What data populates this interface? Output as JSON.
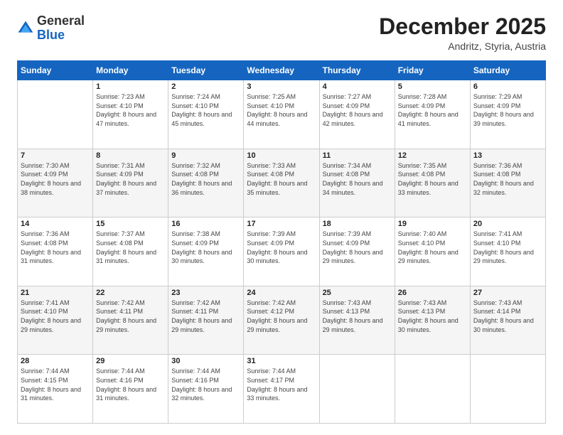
{
  "header": {
    "logo_general": "General",
    "logo_blue": "Blue",
    "month_title": "December 2025",
    "location": "Andritz, Styria, Austria"
  },
  "weekdays": [
    "Sunday",
    "Monday",
    "Tuesday",
    "Wednesday",
    "Thursday",
    "Friday",
    "Saturday"
  ],
  "weeks": [
    [
      {
        "day": "",
        "sunrise": "",
        "sunset": "",
        "daylight": ""
      },
      {
        "day": "1",
        "sunrise": "Sunrise: 7:23 AM",
        "sunset": "Sunset: 4:10 PM",
        "daylight": "Daylight: 8 hours and 47 minutes."
      },
      {
        "day": "2",
        "sunrise": "Sunrise: 7:24 AM",
        "sunset": "Sunset: 4:10 PM",
        "daylight": "Daylight: 8 hours and 45 minutes."
      },
      {
        "day": "3",
        "sunrise": "Sunrise: 7:25 AM",
        "sunset": "Sunset: 4:10 PM",
        "daylight": "Daylight: 8 hours and 44 minutes."
      },
      {
        "day": "4",
        "sunrise": "Sunrise: 7:27 AM",
        "sunset": "Sunset: 4:09 PM",
        "daylight": "Daylight: 8 hours and 42 minutes."
      },
      {
        "day": "5",
        "sunrise": "Sunrise: 7:28 AM",
        "sunset": "Sunset: 4:09 PM",
        "daylight": "Daylight: 8 hours and 41 minutes."
      },
      {
        "day": "6",
        "sunrise": "Sunrise: 7:29 AM",
        "sunset": "Sunset: 4:09 PM",
        "daylight": "Daylight: 8 hours and 39 minutes."
      }
    ],
    [
      {
        "day": "7",
        "sunrise": "Sunrise: 7:30 AM",
        "sunset": "Sunset: 4:09 PM",
        "daylight": "Daylight: 8 hours and 38 minutes."
      },
      {
        "day": "8",
        "sunrise": "Sunrise: 7:31 AM",
        "sunset": "Sunset: 4:09 PM",
        "daylight": "Daylight: 8 hours and 37 minutes."
      },
      {
        "day": "9",
        "sunrise": "Sunrise: 7:32 AM",
        "sunset": "Sunset: 4:08 PM",
        "daylight": "Daylight: 8 hours and 36 minutes."
      },
      {
        "day": "10",
        "sunrise": "Sunrise: 7:33 AM",
        "sunset": "Sunset: 4:08 PM",
        "daylight": "Daylight: 8 hours and 35 minutes."
      },
      {
        "day": "11",
        "sunrise": "Sunrise: 7:34 AM",
        "sunset": "Sunset: 4:08 PM",
        "daylight": "Daylight: 8 hours and 34 minutes."
      },
      {
        "day": "12",
        "sunrise": "Sunrise: 7:35 AM",
        "sunset": "Sunset: 4:08 PM",
        "daylight": "Daylight: 8 hours and 33 minutes."
      },
      {
        "day": "13",
        "sunrise": "Sunrise: 7:36 AM",
        "sunset": "Sunset: 4:08 PM",
        "daylight": "Daylight: 8 hours and 32 minutes."
      }
    ],
    [
      {
        "day": "14",
        "sunrise": "Sunrise: 7:36 AM",
        "sunset": "Sunset: 4:08 PM",
        "daylight": "Daylight: 8 hours and 31 minutes."
      },
      {
        "day": "15",
        "sunrise": "Sunrise: 7:37 AM",
        "sunset": "Sunset: 4:08 PM",
        "daylight": "Daylight: 8 hours and 31 minutes."
      },
      {
        "day": "16",
        "sunrise": "Sunrise: 7:38 AM",
        "sunset": "Sunset: 4:09 PM",
        "daylight": "Daylight: 8 hours and 30 minutes."
      },
      {
        "day": "17",
        "sunrise": "Sunrise: 7:39 AM",
        "sunset": "Sunset: 4:09 PM",
        "daylight": "Daylight: 8 hours and 30 minutes."
      },
      {
        "day": "18",
        "sunrise": "Sunrise: 7:39 AM",
        "sunset": "Sunset: 4:09 PM",
        "daylight": "Daylight: 8 hours and 29 minutes."
      },
      {
        "day": "19",
        "sunrise": "Sunrise: 7:40 AM",
        "sunset": "Sunset: 4:10 PM",
        "daylight": "Daylight: 8 hours and 29 minutes."
      },
      {
        "day": "20",
        "sunrise": "Sunrise: 7:41 AM",
        "sunset": "Sunset: 4:10 PM",
        "daylight": "Daylight: 8 hours and 29 minutes."
      }
    ],
    [
      {
        "day": "21",
        "sunrise": "Sunrise: 7:41 AM",
        "sunset": "Sunset: 4:10 PM",
        "daylight": "Daylight: 8 hours and 29 minutes."
      },
      {
        "day": "22",
        "sunrise": "Sunrise: 7:42 AM",
        "sunset": "Sunset: 4:11 PM",
        "daylight": "Daylight: 8 hours and 29 minutes."
      },
      {
        "day": "23",
        "sunrise": "Sunrise: 7:42 AM",
        "sunset": "Sunset: 4:11 PM",
        "daylight": "Daylight: 8 hours and 29 minutes."
      },
      {
        "day": "24",
        "sunrise": "Sunrise: 7:42 AM",
        "sunset": "Sunset: 4:12 PM",
        "daylight": "Daylight: 8 hours and 29 minutes."
      },
      {
        "day": "25",
        "sunrise": "Sunrise: 7:43 AM",
        "sunset": "Sunset: 4:13 PM",
        "daylight": "Daylight: 8 hours and 29 minutes."
      },
      {
        "day": "26",
        "sunrise": "Sunrise: 7:43 AM",
        "sunset": "Sunset: 4:13 PM",
        "daylight": "Daylight: 8 hours and 30 minutes."
      },
      {
        "day": "27",
        "sunrise": "Sunrise: 7:43 AM",
        "sunset": "Sunset: 4:14 PM",
        "daylight": "Daylight: 8 hours and 30 minutes."
      }
    ],
    [
      {
        "day": "28",
        "sunrise": "Sunrise: 7:44 AM",
        "sunset": "Sunset: 4:15 PM",
        "daylight": "Daylight: 8 hours and 31 minutes."
      },
      {
        "day": "29",
        "sunrise": "Sunrise: 7:44 AM",
        "sunset": "Sunset: 4:16 PM",
        "daylight": "Daylight: 8 hours and 31 minutes."
      },
      {
        "day": "30",
        "sunrise": "Sunrise: 7:44 AM",
        "sunset": "Sunset: 4:16 PM",
        "daylight": "Daylight: 8 hours and 32 minutes."
      },
      {
        "day": "31",
        "sunrise": "Sunrise: 7:44 AM",
        "sunset": "Sunset: 4:17 PM",
        "daylight": "Daylight: 8 hours and 33 minutes."
      },
      {
        "day": "",
        "sunrise": "",
        "sunset": "",
        "daylight": ""
      },
      {
        "day": "",
        "sunrise": "",
        "sunset": "",
        "daylight": ""
      },
      {
        "day": "",
        "sunrise": "",
        "sunset": "",
        "daylight": ""
      }
    ]
  ]
}
